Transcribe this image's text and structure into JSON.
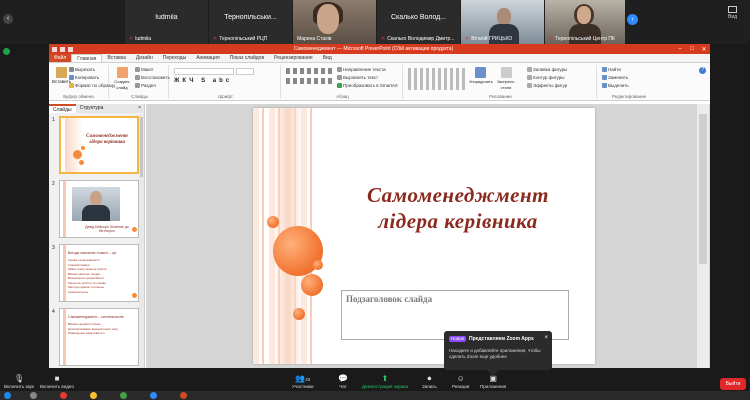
{
  "gallery": {
    "participants": [
      {
        "display": "",
        "label": "ludmila"
      },
      {
        "display": "ludmila",
        "label": ""
      },
      {
        "display": "Тернопільськи...",
        "label": "Тернопільський РЦП"
      },
      {
        "display": "",
        "label": "Марина Стахів"
      },
      {
        "display": "Скалько Волод...",
        "label": "Скалько Володимир Дмитр..."
      },
      {
        "display": "",
        "label": "Віталій ГРИЦЬКО"
      },
      {
        "display": "",
        "label": "Тернопільський Центр ПК"
      }
    ],
    "view_label": "Вид"
  },
  "ppt": {
    "window_title": "Самоменеджмент — Microsoft PowerPoint (Сбій активации продукта)",
    "tabs": [
      "Файл",
      "Главная",
      "Вставка",
      "Дизайн",
      "Переходы",
      "Анимация",
      "Показ слайдов",
      "Рецензирование",
      "Вид"
    ],
    "ribbon": {
      "paste": "Вставить",
      "cut": "Вырезать",
      "copy": "Копировать",
      "format_painter": "Формат по образцу",
      "clipboard": "Буфер обмена",
      "new_slide": "Создать слайд",
      "layout": "Макет",
      "reset": "Восстановить",
      "section": "Раздел",
      "slides": "Слайды",
      "font": "Шрифт",
      "text_direction": "Направление текста",
      "align_text": "Выровнять текст",
      "smartart": "Преобразовать в SmartArt",
      "paragraph": "Абзац",
      "arrange": "Упорядочить",
      "quick_styles": "Экспресс-стили",
      "shape_fill": "Заливка фигуры",
      "shape_outline": "Контур фигуры",
      "shape_effects": "Эффекты фигур",
      "drawing": "Рисование",
      "find": "Найти",
      "replace": "Заменить",
      "select": "Выделить",
      "editing": "Редактирование"
    },
    "pane": {
      "tab_slides": "Слайды",
      "tab_outline": "Структура",
      "close": "×",
      "thumbs": [
        {
          "num": "1",
          "title": "Самоменеджмент лідера керівника"
        },
        {
          "num": "2",
          "caption": "Девід Бейкорн Girstman до Ветінгрон"
        },
        {
          "num": "3",
          "title": "Вигоди навчання «само» – це:",
          "bullets": [
            "Оцінка організованості",
            "Самомотивація",
            "Зміна темпу власної роботи",
            "Вміння загальні лицарі",
            "Визначення професійного",
            "Контроль роботи та справи",
            "Методи прийняття рішень",
            "Самоконтроль"
          ]
        },
        {
          "num": "4",
          "title": "Самоменеджмент – систематичне",
          "bullets": [
            "Вміння керувати собою",
            "Цілеспрямоване використання часу",
            "Підвищення ефективності"
          ]
        }
      ]
    },
    "slide": {
      "title_line1": "Самоменеджмент",
      "title_line2": "лідера керівника",
      "subtitle_placeholder": "Подзаголовок слайда"
    }
  },
  "popup": {
    "badge": "Новое",
    "title": "Представляем Zoom Apps",
    "close": "×",
    "text": "Находите и добавляйте приложения, чтобы сделать Zoom еще удобнее"
  },
  "controls": {
    "mute": "Включить звук",
    "video": "Включить видео",
    "participants": "Участники",
    "participants_count": "43",
    "chat": "Чат",
    "share": "Демонстрация экрана",
    "record": "Запись",
    "reactions": "Реакции",
    "apps": "Приложения",
    "end": "Выйти"
  }
}
